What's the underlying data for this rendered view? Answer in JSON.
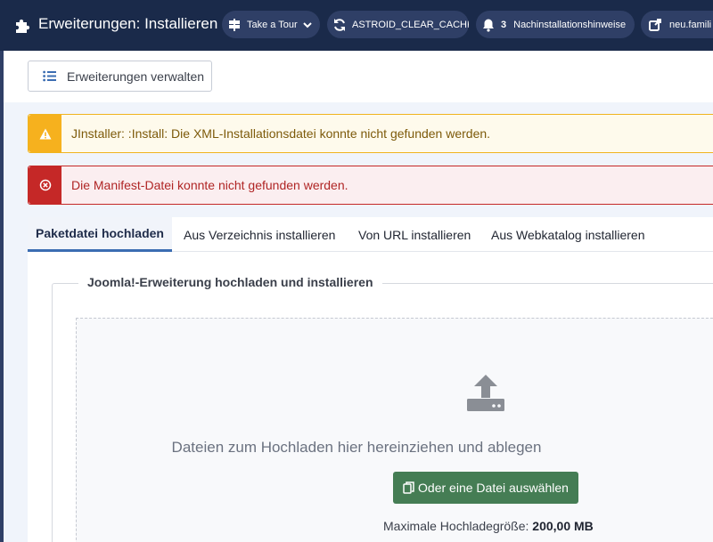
{
  "header": {
    "title": "Erweiterungen: Installieren",
    "pills": [
      {
        "label": "Take a Tour",
        "icon": "signpost-icon"
      },
      {
        "label": "ASTROID_CLEAR_CACHE",
        "icon": "refresh-icon"
      },
      {
        "count": "3",
        "label": "Nachinstallationshinweise",
        "icon": "bell-icon"
      },
      {
        "label": "neu.famili",
        "icon": "external-link-icon"
      }
    ]
  },
  "toolbar": {
    "manage_label": "Erweiterungen verwalten"
  },
  "alerts": {
    "warning": "JInstaller: :Install: Die XML-Installationsdatei konnte nicht gefunden werden.",
    "danger": "Die Manifest-Datei konnte nicht gefunden werden."
  },
  "tabs": [
    {
      "label": "Paketdatei hochladen",
      "active": true
    },
    {
      "label": "Aus Verzeichnis installieren"
    },
    {
      "label": "Von URL installieren"
    },
    {
      "label": "Aus Webkatalog installieren"
    }
  ],
  "upload": {
    "legend": "Joomla!-Erweiterung hochladen und installieren",
    "drop_text": "Dateien zum Hochladen hier hereinziehen und ablegen",
    "choose_label": "Oder eine Datei auswählen",
    "max_label": "Maximale Hochladegröße:",
    "max_value": "200,00 MB"
  },
  "colors": {
    "header_bg": "#1a2a4a",
    "pill_bg": "#2f3f66",
    "warning": "#f6b11e",
    "danger": "#c52827",
    "success": "#457d54",
    "tab_accent": "#3b6db2"
  }
}
